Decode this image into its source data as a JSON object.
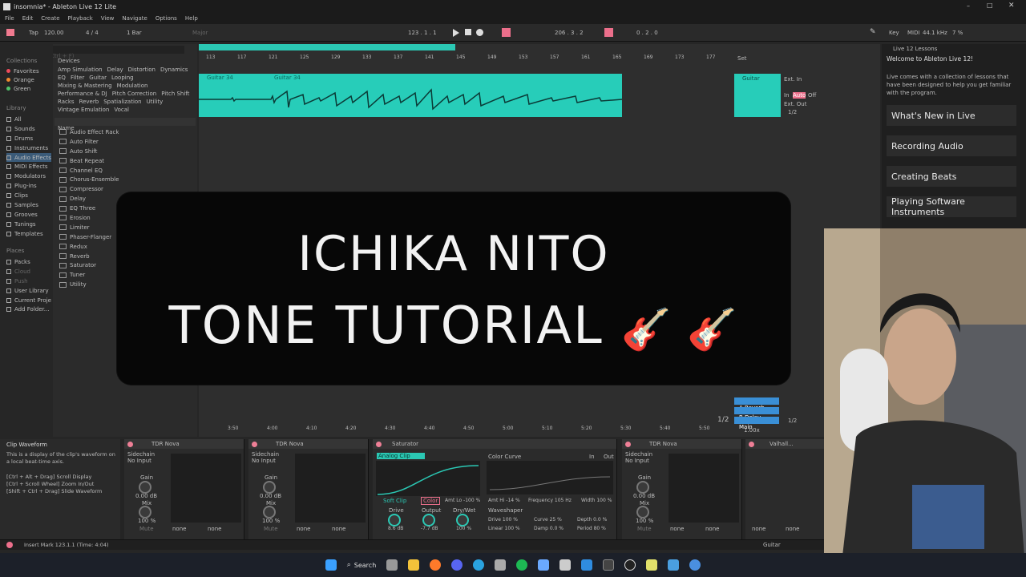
{
  "window": {
    "title": "insomnia* - Ableton Live 12 Lite"
  },
  "menu": [
    "File",
    "Edit",
    "Create",
    "Playback",
    "View",
    "Navigate",
    "Options",
    "Help"
  ],
  "transport": {
    "tap": "Tap",
    "tempo": "120.00",
    "signature": "4 / 4",
    "bar": "1 Bar",
    "key": "Major",
    "position": "123 . 1 . 1",
    "position2": "206 . 3 . 2",
    "end": "0 . 2 . 0",
    "key_label": "Key",
    "midi": "MIDI",
    "sample_rate": "44.1 kHz",
    "cpu": "7 %"
  },
  "browser": {
    "search_placeholder": "Search (Ctrl + F)",
    "collections_label": "Collections",
    "collections": [
      "Favorites",
      "Orange",
      "Green"
    ],
    "library_label": "Library",
    "library": [
      "All",
      "Sounds",
      "Drums",
      "Instruments",
      "Audio Effects",
      "MIDI Effects",
      "Modulators",
      "Plug-ins",
      "Clips",
      "Samples",
      "Grooves",
      "Tunings",
      "Templates"
    ],
    "places_label": "Places",
    "places": [
      "Packs",
      "Cloud",
      "Push",
      "User Library",
      "Current Proje",
      "Add Folder..."
    ],
    "devices_label": "Devices",
    "tags_row1": [
      "Amp Simulation",
      "Delay",
      "Distortion",
      "Dynamics"
    ],
    "tags_row2": [
      "EQ",
      "Filter",
      "Guitar",
      "Looping"
    ],
    "tags_row3": [
      "Mixing & Mastering",
      "Modulation"
    ],
    "tags_row4": [
      "Performance & DJ",
      "Pitch Correction",
      "Pitch Shift"
    ],
    "tags_row5": [
      "Racks",
      "Reverb",
      "Spatialization",
      "Utility"
    ],
    "tags_row6": [
      "Vintage Emulation",
      "Vocal"
    ],
    "name_header": "Name",
    "items": [
      "Audio Effect Rack",
      "Auto Filter",
      "Auto Shift",
      "Beat Repeat",
      "Channel EQ",
      "Chorus-Ensemble",
      "Compressor",
      "Delay",
      "EQ Three",
      "Erosion",
      "Limiter",
      "Phaser-Flanger",
      "Redux",
      "Reverb",
      "Saturator",
      "Tuner",
      "Utility"
    ]
  },
  "arrangement": {
    "ruler": [
      "113",
      "117",
      "121",
      "125",
      "129",
      "133",
      "137",
      "141",
      "145",
      "149",
      "153",
      "157",
      "161",
      "165",
      "169",
      "173",
      "177"
    ],
    "clip_name": "Guitar 34",
    "time_ruler": [
      "3:50",
      "4:00",
      "4:10",
      "4:20",
      "4:30",
      "4:40",
      "4:50",
      "5:00",
      "5:10",
      "5:20",
      "5:30",
      "5:40",
      "5:50"
    ],
    "track_name": "Guitar",
    "set_label": "Set",
    "ext_in": "Ext. In",
    "ext_out": "Ext. Out",
    "io_value": "1/2",
    "in_label": "In",
    "auto_label": "Auto",
    "off_label": "Off",
    "returns": [
      "A Reverb",
      "B Delay",
      "Main"
    ],
    "main_value": "1.00x",
    "io_bottom": "1/2"
  },
  "lessons": {
    "header": "Live 12 Lessons",
    "welcome": "Welcome to Ableton Live 12!",
    "intro": "Live comes with a collection of lessons that have been designed to help you get familiar with the program.",
    "buttons": [
      "What's New in Live",
      "Recording Audio",
      "Creating Beats",
      "Playing Software Instruments"
    ]
  },
  "clip_info": {
    "title": "Clip Waveform",
    "text": "This is a display of the clip's waveform on a local beat-time axis.",
    "shortcuts": [
      "[Ctrl + Alt + Drag] Scroll Display",
      "[Ctrl + Scroll Wheel] Zoom In/Out",
      "[Shift + Ctrl + Drag] Slide Waveform"
    ]
  },
  "devices": {
    "tdr1": "TDR Nova",
    "tdr2": "TDR Nova",
    "saturator": "Saturator",
    "tdr3": "TDR Nova",
    "valhalla": "Valhall...",
    "sidechain": "Sidechain",
    "no_input": "No Input",
    "gain": "Gain",
    "gain_val": "0.00 dB",
    "mix": "Mix",
    "mix_val": "100 %",
    "mute": "Mute",
    "none": "none",
    "sat_mode": "Analog Clip",
    "color_curve": "Color Curve",
    "soft_clip": "Soft Clip",
    "color_btn": "Color",
    "amt_lo": "Amt Lo -100 %",
    "amt_hi": "Amt Hi -14 %",
    "freq": "Frequency 105 Hz",
    "width": "Width 100 %",
    "in_lbl": "In",
    "out_lbl": "Out",
    "drive": "Drive",
    "drive_val": "8.6 dB",
    "output": "Output",
    "output_val": "-7.7 dB",
    "drywet": "Dry/Wet",
    "drywet_val": "100 %",
    "waveshaper": "Waveshaper",
    "ws_drive": "Drive 100 %",
    "ws_curve": "Curve 25 %",
    "ws_depth": "Depth 0.0 %",
    "ws_lin": "Linear 100 %",
    "ws_damp": "Damp 0.0 %",
    "ws_period": "Period 80 %"
  },
  "status": {
    "text": "Insert Mark 123.1.1 (Time: 4:04)",
    "track": "Guitar"
  },
  "overlay": {
    "line1": "ICHIKA NITO",
    "line2": "TONE TUTORIAL",
    "emoji": "🎸 🎸"
  },
  "taskbar": {
    "search": "Search"
  }
}
